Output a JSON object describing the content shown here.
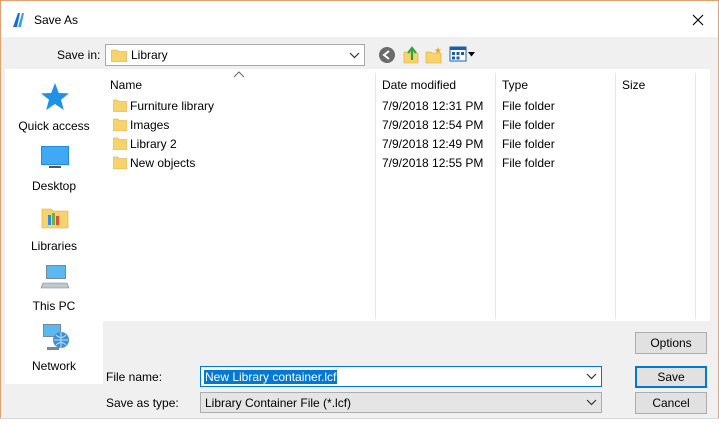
{
  "window": {
    "title": "Save As"
  },
  "save_in": {
    "label": "Save in:",
    "value": "Library"
  },
  "places": [
    {
      "label": "Quick access",
      "icon": "star-icon"
    },
    {
      "label": "Desktop",
      "icon": "desktop-icon"
    },
    {
      "label": "Libraries",
      "icon": "libraries-icon"
    },
    {
      "label": "This PC",
      "icon": "computer-icon"
    },
    {
      "label": "Network",
      "icon": "network-icon"
    }
  ],
  "file_list": {
    "columns": [
      "Name",
      "Date modified",
      "Type",
      "Size"
    ],
    "rows": [
      {
        "name": "Furniture library",
        "date": "7/9/2018 12:31 PM",
        "type": "File folder",
        "size": ""
      },
      {
        "name": "Images",
        "date": "7/9/2018 12:54 PM",
        "type": "File folder",
        "size": ""
      },
      {
        "name": "Library 2",
        "date": "7/9/2018 12:49 PM",
        "type": "File folder",
        "size": ""
      },
      {
        "name": "New objects",
        "date": "7/9/2018 12:55 PM",
        "type": "File folder",
        "size": ""
      }
    ]
  },
  "file_name": {
    "label": "File name:",
    "value": "New Library container.lcf"
  },
  "save_as_type": {
    "label": "Save as type:",
    "value": "Library Container File (*.lcf)"
  },
  "buttons": {
    "options": "Options",
    "save": "Save",
    "cancel": "Cancel"
  },
  "colors": {
    "accent": "#0078d7",
    "folder": "#f7d36b",
    "window_border": "#e8a070"
  }
}
